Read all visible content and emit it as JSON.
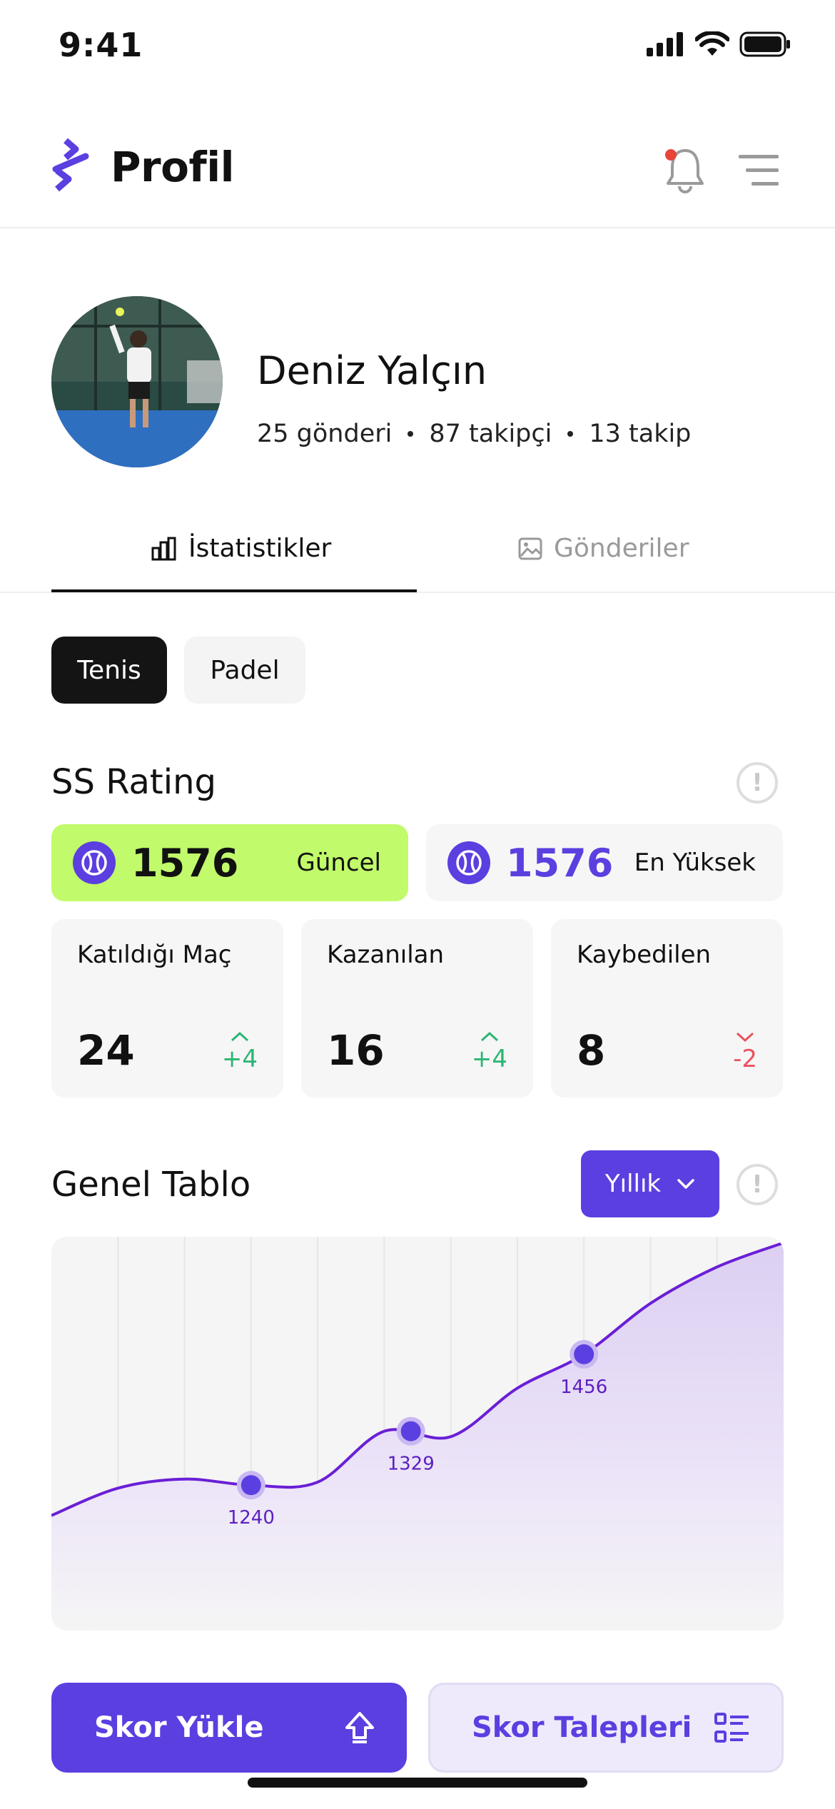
{
  "status_bar": {
    "time": "9:41"
  },
  "header": {
    "title": "Profil"
  },
  "profile": {
    "name": "Deniz Yalçın",
    "posts": "25 gönderi",
    "followers": "87 takipçi",
    "following": "13 takip"
  },
  "tabs": [
    {
      "label": "İstatistikler",
      "active": true
    },
    {
      "label": "Gönderiler",
      "active": false
    }
  ],
  "sports": [
    {
      "label": "Tenis",
      "selected": true
    },
    {
      "label": "Padel",
      "selected": false
    }
  ],
  "ss_rating": {
    "title": "SS Rating",
    "current": {
      "value": "1576",
      "label": "Güncel"
    },
    "highest": {
      "value": "1576",
      "label": "En Yüksek"
    }
  },
  "stats": [
    {
      "label": "Katıldığı Maç",
      "value": "24",
      "delta": "+4",
      "trend": "up"
    },
    {
      "label": "Kazanılan",
      "value": "16",
      "delta": "+4",
      "trend": "up"
    },
    {
      "label": "Kaybedilen",
      "value": "8",
      "delta": "-2",
      "trend": "down"
    }
  ],
  "general_table": {
    "title": "Genel Tablo",
    "period": "Yıllık"
  },
  "chart_data": {
    "type": "area",
    "title": "",
    "xlabel": "",
    "ylabel": "",
    "x": [
      0,
      1,
      2,
      3,
      4,
      5,
      6,
      7,
      8,
      9,
      10,
      11
    ],
    "series": [
      {
        "values": [
          1190,
          1235,
          1250,
          1240,
          1245,
          1329,
          1320,
          1400,
          1456,
          1540,
          1600,
          1640
        ]
      }
    ],
    "data_labels": [
      {
        "x": 3,
        "value": "1240"
      },
      {
        "x": 5.4,
        "value": "1329"
      },
      {
        "x": 8,
        "value": "1456"
      }
    ],
    "grid": true
  },
  "actions": {
    "upload_label": "Skor Yükle",
    "requests_label": "Skor Talepleri"
  },
  "colors": {
    "accent": "#5b3fe0",
    "rating_current_bg": "#c1fa6a",
    "positive": "#2bb673",
    "negative": "#e8525f"
  }
}
